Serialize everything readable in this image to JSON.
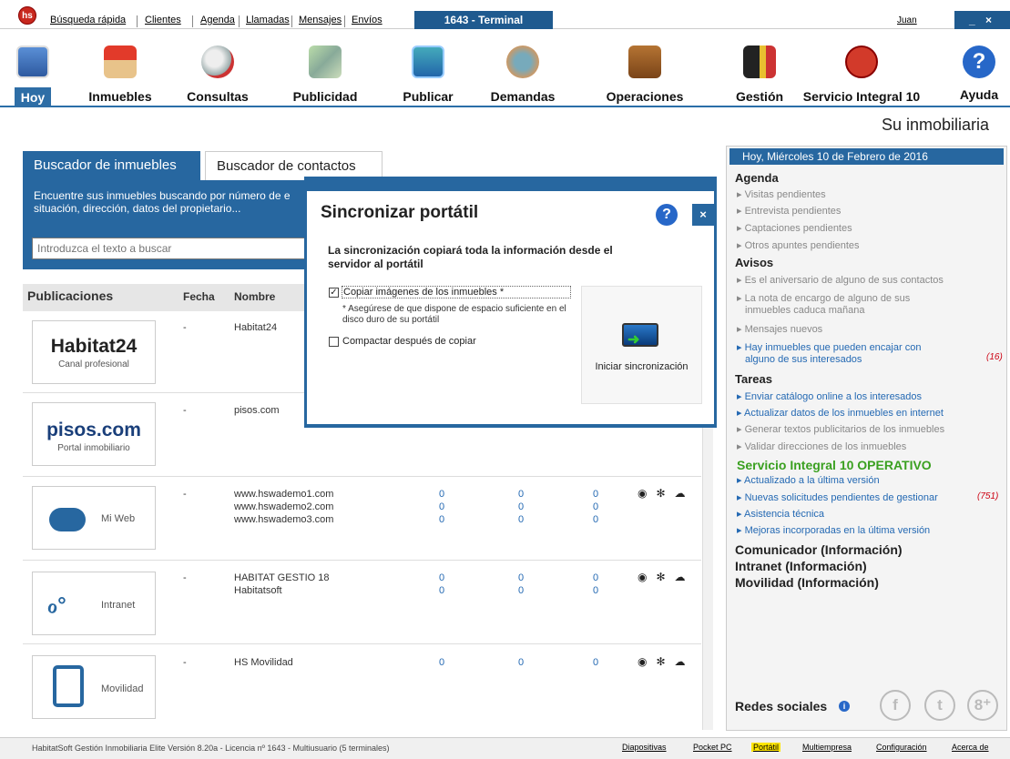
{
  "top_nav": {
    "logo": "hs",
    "links": [
      "Búsqueda rápida",
      "Clientes",
      "Agenda",
      "Llamadas",
      "Mensajes",
      "Envíos"
    ],
    "terminal_label": "1643 - Terminal",
    "user": "Juan",
    "window_controls": "_ ×"
  },
  "toolbar": {
    "items": [
      {
        "label": "Hoy",
        "icon": "calendar-icon"
      },
      {
        "label": "Inmuebles",
        "icon": "house-icon"
      },
      {
        "label": "Consultas",
        "icon": "magnifier-icon"
      },
      {
        "label": "Publicidad",
        "icon": "billboard-icon"
      },
      {
        "label": "Publicar",
        "icon": "publish-icon"
      },
      {
        "label": "Demandas",
        "icon": "people-icon"
      },
      {
        "label": "Operaciones",
        "icon": "briefcase-icon"
      },
      {
        "label": "Gestión",
        "icon": "door-icon"
      },
      {
        "label": "Servicio Integral 10",
        "icon": "hs-logo-icon"
      },
      {
        "label": "Ayuda",
        "icon": "help-icon"
      }
    ]
  },
  "tagline": "Su inmobiliaria",
  "search": {
    "tab_active": "Buscador de inmuebles",
    "tab_other": "Buscador de contactos",
    "description": "Encuentre sus inmuebles buscando por número de e situación, dirección, datos del propietario...",
    "placeholder": "Introduzca el texto a buscar"
  },
  "publications": {
    "headers": [
      "Publicaciones",
      "Fecha",
      "Nombre"
    ],
    "rows": [
      {
        "logo_main": "Habitat24",
        "logo_sub": "Canal profesional",
        "date": "-",
        "names": [
          "Habitat24"
        ],
        "nums": []
      },
      {
        "logo_main": "pisos.com",
        "logo_sub": "Portal inmobiliario",
        "date": "-",
        "names": [
          "pisos.com"
        ],
        "nums": []
      },
      {
        "logo_main": "Mi Web",
        "date": "-",
        "names": [
          "www.hswademo1.com",
          "www.hswademo2.com",
          "www.hswademo3.com"
        ],
        "nums": [
          "0",
          "0",
          "0"
        ]
      },
      {
        "logo_main": "Intranet",
        "date": "-",
        "names": [
          "HABITAT GESTIO 18",
          "Habitatsoft"
        ],
        "nums": [
          "0",
          "0"
        ]
      },
      {
        "logo_main": "Movilidad",
        "date": "-",
        "names": [
          "HS Movilidad"
        ],
        "nums": [
          "0"
        ]
      }
    ]
  },
  "right_panel": {
    "date": "Hoy, Miércoles 10 de Febrero de 2016",
    "agenda_title": "Agenda",
    "agenda": [
      "Visitas pendientes",
      "Entrevista pendientes",
      "Captaciones pendientes",
      "Otros apuntes pendientes"
    ],
    "avisos_title": "Avisos",
    "avisos": [
      "Es el aniversario de alguno de sus contactos",
      "La nota de encargo de alguno de sus",
      "inmuebles caduca mañana",
      "Mensajes nuevos",
      "Hay inmuebles que pueden encajar con",
      "alguno de sus interesados"
    ],
    "avisos_count": "(16)",
    "tareas_title": "Tareas",
    "tareas": [
      "Enviar catálogo online a los interesados",
      "Actualizar datos de los inmuebles en internet",
      "Generar textos publicitarios de los inmuebles",
      "Validar direcciones de los inmuebles"
    ],
    "si_title": "Servicio Integral 10 OPERATIVO",
    "si_items": [
      "Actualizado a la última versión",
      "Nuevas solicitudes pendientes de gestionar",
      "Asistencia técnica",
      "Mejoras incorporadas en la última versión"
    ],
    "si_count": "(751)",
    "info": [
      "Comunicador (Información)",
      "Intranet (Información)",
      "Movilidad (Información)"
    ],
    "social_title": "Redes sociales"
  },
  "status_bar": {
    "text": "HabitatSoft Gestión Inmobiliaria Elite Versión 8.20a - Licencia nº 1643 - Multiusuario  (5 terminales)",
    "links": [
      "Diapositivas",
      "Pocket PC",
      "Portátil",
      "Multiempresa",
      "Configuración",
      "Acerca de"
    ]
  },
  "modal": {
    "title": "Sincronizar portátil",
    "help": "?",
    "close": "×",
    "message": "La sincronización copiará toda la información desde el servidor al portátil",
    "option_copy": "Copiar imágenes de los inmuebles *",
    "option_note": "* Asegúrese de que dispone de espacio suficiente en el disco duro de su portátil",
    "option_compact": "Compactar después de copiar",
    "sync_button": "Iniciar sincronización"
  }
}
